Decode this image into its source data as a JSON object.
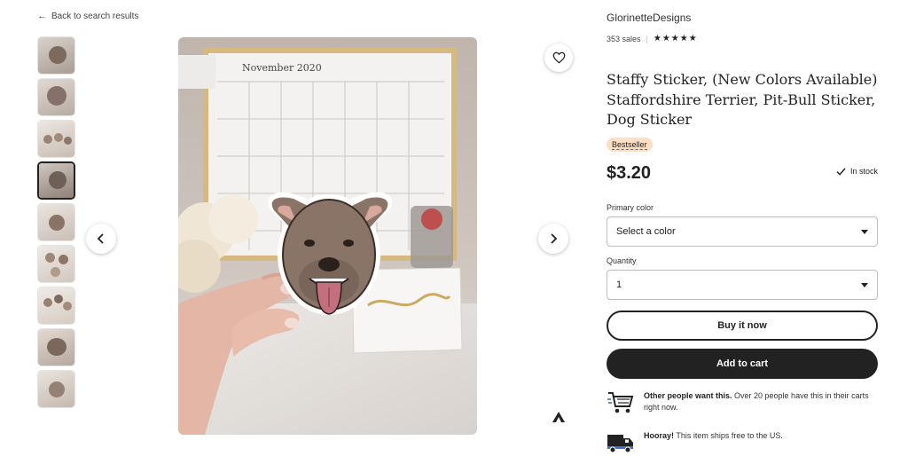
{
  "nav": {
    "back_label": "Back to search results",
    "back_arrow": "←"
  },
  "gallery": {
    "thumbnail_count": 9,
    "active_index": 3
  },
  "shop": {
    "name": "GlorinetteDesigns",
    "sales": "353 sales",
    "rating_stars": "★★★★★"
  },
  "product": {
    "title": "Staffy Sticker, (New Colors Available) Staffordshire Terrier, Pit-Bull Sticker, Dog Sticker",
    "badge": "Bestseller",
    "price": "$3.20",
    "stock": "In stock"
  },
  "options": {
    "color_label": "Primary color",
    "color_value": "Select a color",
    "quantity_label": "Quantity",
    "quantity_value": "1"
  },
  "actions": {
    "buy_now": "Buy it now",
    "add_to_cart": "Add to cart"
  },
  "notices": {
    "demand_bold": "Other people want this.",
    "demand_text": " Over 20 people have this in their carts right now.",
    "shipping_bold": "Hooray!",
    "shipping_text": " This item ships free to the US."
  },
  "image_text": {
    "calendar_month": "November 2020"
  },
  "colors": {
    "accent_dark": "#222222",
    "badge_bg": "#fddfc5",
    "dog_fur": "#8a7468",
    "tongue": "#c56f7e"
  },
  "icons": {
    "back": "arrow-left-icon",
    "favorite": "heart-icon",
    "prev": "chevron-left-icon",
    "next": "chevron-right-icon",
    "stock": "check-icon",
    "cart": "cart-icon",
    "truck": "truck-icon"
  }
}
